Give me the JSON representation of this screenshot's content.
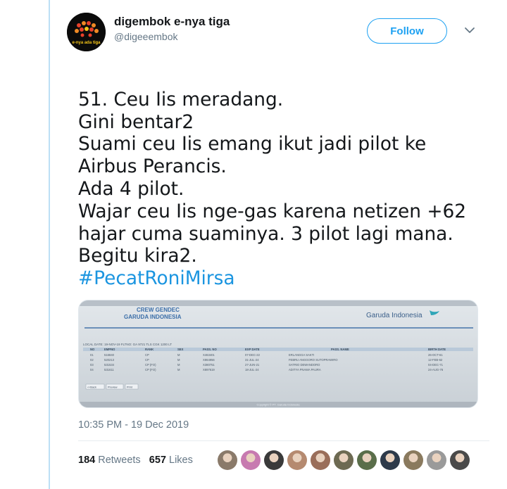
{
  "author": {
    "display_name": "digembok e-nya tiga",
    "handle": "@digeeembok",
    "avatar_caption": "e-nya ada tiga"
  },
  "follow_label": "Follow",
  "tweet": {
    "lines": [
      "51. Ceu Iis meradang.",
      "Gini bentar2",
      "Suami ceu Iis emang ikut jadi pilot ke",
      "Airbus Perancis.",
      "Ada 4 pilot.",
      "Wajar ceu Iis nge-gas karena netizen +62",
      "hajar cuma suaminya. 3 pilot lagi mana.",
      "Begitu kira2."
    ],
    "hashtag": "#PecatRoniMirsa"
  },
  "media": {
    "title_line1": "CREW GENDEC",
    "title_line2": "GARUDA INDONESIA",
    "brand": "Garuda Indonesia",
    "flight_info": "LOCAL DATE: 19-NOV-19  FLTNO: GA 9721  TLS CGK 1200 LT",
    "columns": [
      "NO",
      "EMPNO",
      "RANK",
      "SEX",
      "PASS. NO",
      "EXP DATE",
      "PASS. NAME",
      "BIRTH DATE"
    ],
    "rows": [
      [
        "01",
        "516840",
        "CP",
        "M",
        "X463401",
        "07-DEC-22",
        "ERLANGGA SAKTI",
        "26-OCT-61"
      ],
      [
        "02",
        "520213",
        "CP",
        "M",
        "X864956",
        "31-JUL-24",
        "FEBRU ANGGORO SUTOPRAWIRO",
        "12-FEB-62"
      ],
      [
        "03",
        "531534",
        "CP (FO)",
        "M",
        "X380751",
        "27-JUN-21",
        "SATRIO DEWANDORO",
        "04-DEC-71"
      ],
      [
        "04",
        "531611",
        "CP (FO)",
        "M",
        "X897619",
        "18-JUL-24",
        "ADITYA PNAMA PAURA",
        "24-AUG-76"
      ]
    ],
    "buttons": [
      "<<Back",
      "Preview",
      "Print"
    ],
    "copyright": "Copyright © PT. Garuda Indonesia"
  },
  "timestamp": "10:35 PM - 19 Dec 2019",
  "stats": {
    "retweets_count": "184",
    "retweets_label": "Retweets",
    "likes_count": "657",
    "likes_label": "Likes"
  },
  "liker_avatars": [
    "#8a7a6a",
    "#c77ab0",
    "#3a3a3a",
    "#b58a70",
    "#9a6e5a",
    "#6d6a52",
    "#5a6e4a",
    "#2d3a4a",
    "#8a7a5e",
    "#9a9a9a",
    "#4a4a4a"
  ],
  "colors": {
    "accent": "#1da1f2",
    "hashtag": "#1b95e0",
    "muted": "#657786"
  }
}
